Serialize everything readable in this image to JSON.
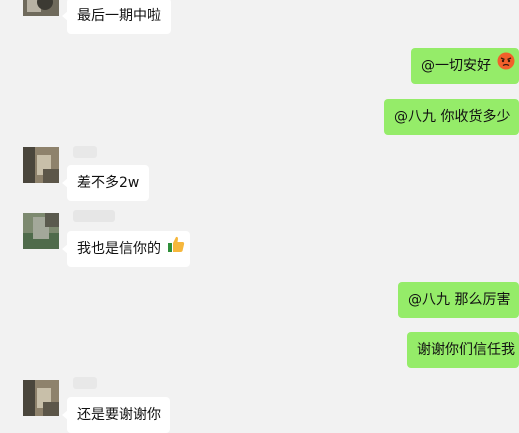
{
  "messages": [
    {
      "side": "in",
      "text": "最后一期中啦"
    },
    {
      "side": "out",
      "text": "@一切安好",
      "emoji": "angry-face-icon"
    },
    {
      "side": "out",
      "text": "@八九  你收货多少"
    },
    {
      "side": "in",
      "text": "差不多2w"
    },
    {
      "side": "in",
      "text": "我也是信你的",
      "emoji": "thumbs-up-icon"
    },
    {
      "side": "out",
      "text": "@八九  那么厉害"
    },
    {
      "side": "out",
      "text": "谢谢你们信任我"
    },
    {
      "side": "in",
      "text": "还是要谢谢你"
    }
  ],
  "colors": {
    "background": "#f2f2f2",
    "outgoing_bubble": "#95ec69",
    "incoming_bubble": "#ffffff"
  }
}
